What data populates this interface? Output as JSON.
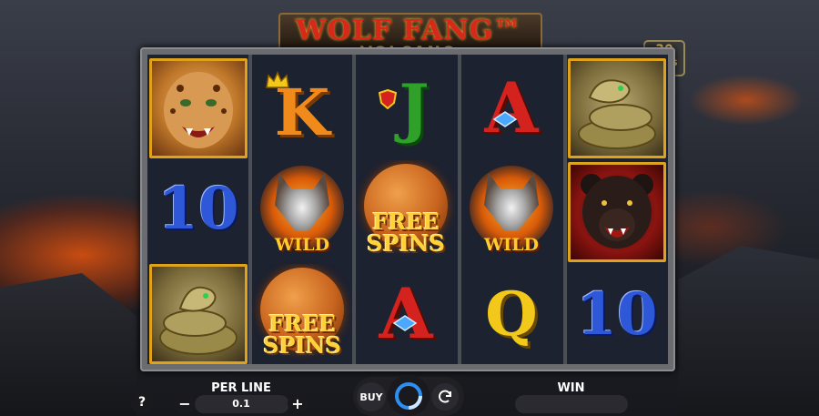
{
  "game": {
    "title": "WOLF FANG™",
    "subtitle": "VOLCANO",
    "lines_badge": {
      "number": "30",
      "label": "LINES"
    }
  },
  "reels": [
    [
      "leopard",
      "10",
      "snake"
    ],
    [
      "K",
      "wolf-wild",
      "free-spins"
    ],
    [
      "J",
      "free-spins",
      "A"
    ],
    [
      "A",
      "wolf-wild",
      "Q"
    ],
    [
      "snake",
      "bear",
      "10"
    ]
  ],
  "symbols": {
    "ten": "10",
    "king": "K",
    "jack": "J",
    "ace": "A",
    "queen": "Q",
    "wild": "WILD",
    "free": "FREE",
    "spins": "SPINS"
  },
  "controls": {
    "help": "?",
    "per_line_label": "PER LINE",
    "per_line_value": "0.1",
    "minus": "−",
    "plus": "+",
    "buy": "BUY",
    "win_label": "WIN"
  },
  "colors": {
    "ten_blue": "#2e58d8",
    "ace_red": "#d4231e",
    "king_orange": "#f08a1a",
    "jack_green": "#2fa02a",
    "queen_yellow": "#f2c81a",
    "gold_frame": "#e0a21a",
    "spin_ring": "#2f8ff0"
  }
}
